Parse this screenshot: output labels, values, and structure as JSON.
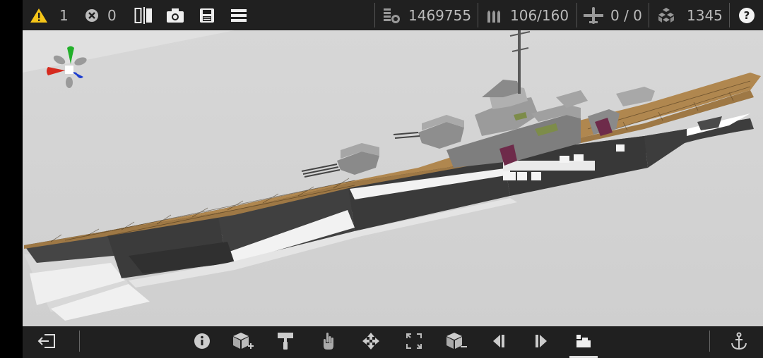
{
  "topbar": {
    "warnings": "1",
    "errors": "0",
    "cost": "1469755",
    "ammo": "106/160",
    "aircraft": "0 / 0",
    "parts": "1345",
    "help_label": "?"
  },
  "colors": {
    "deck": "#b0874f",
    "hull_dark": "#3a3a3a",
    "hull_light": "#ececec",
    "superstructure": "#8c8c8c",
    "accent_purple": "#6e2b4a",
    "accent_green": "#7d8c4a",
    "warning": "#f5c518",
    "bar_bg": "#202020"
  },
  "bottombar": {
    "items": [
      "exit-icon",
      "info-icon",
      "add-part-icon",
      "paint-icon",
      "hand-icon",
      "move-icon",
      "resize-icon",
      "remove-part-icon",
      "step-back-icon",
      "step-forward-icon",
      "build-icon",
      "anchor-icon"
    ]
  }
}
